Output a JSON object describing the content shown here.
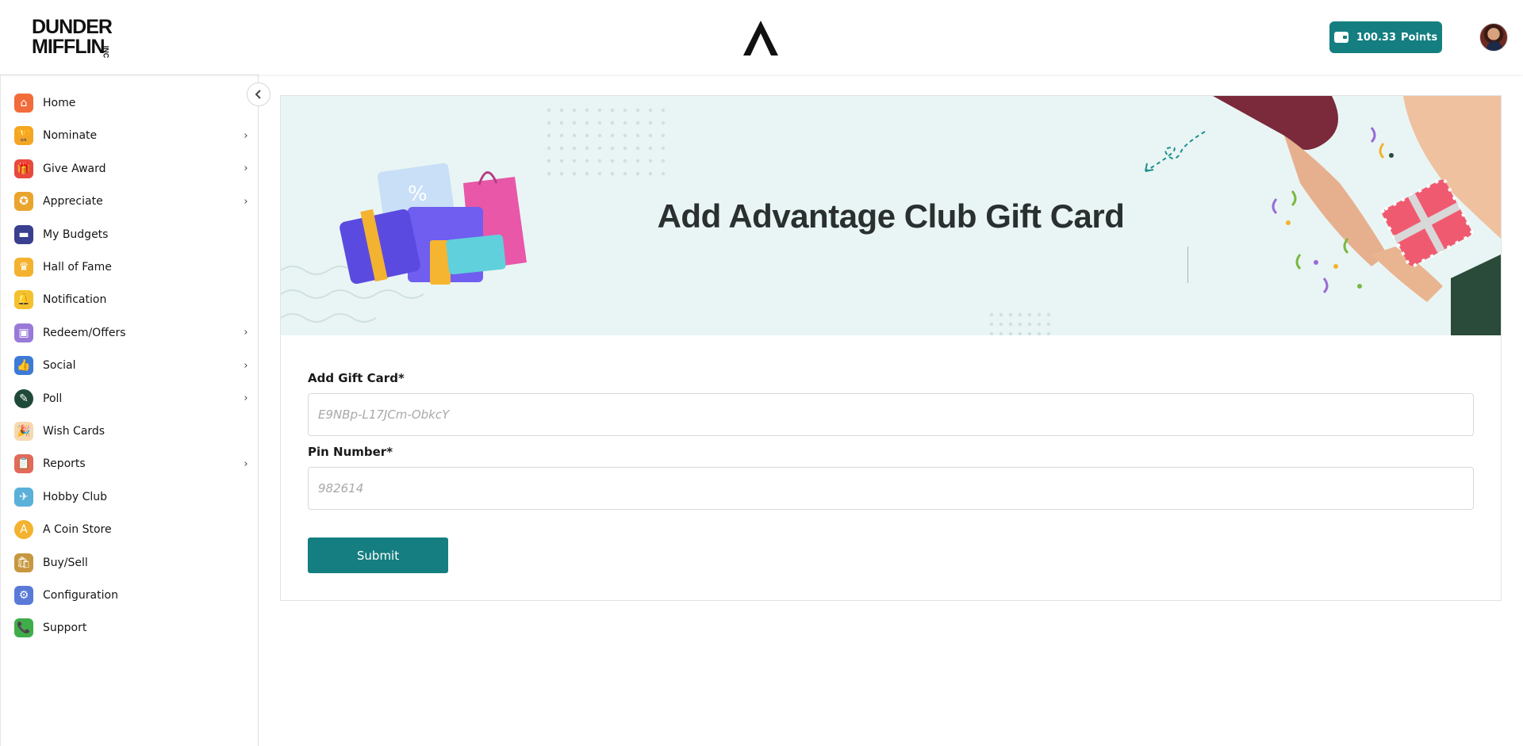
{
  "header": {
    "logo_line1": "DUNDER",
    "logo_line2": "MIFFLIN",
    "logo_suffix": "INC",
    "points_value": "100.33",
    "points_label": "Points"
  },
  "sidebar": {
    "items": [
      {
        "label": "Home",
        "icon": "home-icon",
        "has_submenu": false
      },
      {
        "label": "Nominate",
        "icon": "trophy-icon",
        "has_submenu": true
      },
      {
        "label": "Give Award",
        "icon": "gift-icon",
        "has_submenu": true
      },
      {
        "label": "Appreciate",
        "icon": "medal-icon",
        "has_submenu": true
      },
      {
        "label": "My Budgets",
        "icon": "wallet-icon",
        "has_submenu": false
      },
      {
        "label": "Hall of Fame",
        "icon": "crown-icon",
        "has_submenu": false
      },
      {
        "label": "Notification",
        "icon": "bell-icon",
        "has_submenu": false
      },
      {
        "label": "Redeem/Offers",
        "icon": "redeem-icon",
        "has_submenu": true
      },
      {
        "label": "Social",
        "icon": "social-icon",
        "has_submenu": true
      },
      {
        "label": "Poll",
        "icon": "poll-icon",
        "has_submenu": true
      },
      {
        "label": "Wish Cards",
        "icon": "party-popper-icon",
        "has_submenu": false
      },
      {
        "label": "Reports",
        "icon": "clipboard-icon",
        "has_submenu": true
      },
      {
        "label": "Hobby Club",
        "icon": "hobby-icon",
        "has_submenu": false
      },
      {
        "label": "A Coin Store",
        "icon": "coin-icon",
        "has_submenu": false
      },
      {
        "label": "Buy/Sell",
        "icon": "shopping-bags-icon",
        "has_submenu": false
      },
      {
        "label": "Configuration",
        "icon": "config-icon",
        "has_submenu": false
      },
      {
        "label": "Support",
        "icon": "phone-icon",
        "has_submenu": false
      }
    ]
  },
  "banner": {
    "title": "Add Advantage Club Gift Card"
  },
  "form": {
    "gift_card_label": "Add Gift Card*",
    "gift_card_placeholder": "E9NBp-L17JCm-ObkcY",
    "pin_label": "Pin Number*",
    "pin_placeholder": "982614",
    "submit_label": "Submit"
  },
  "colors": {
    "accent": "#147e80",
    "banner_bg": "#e9f5f4"
  }
}
